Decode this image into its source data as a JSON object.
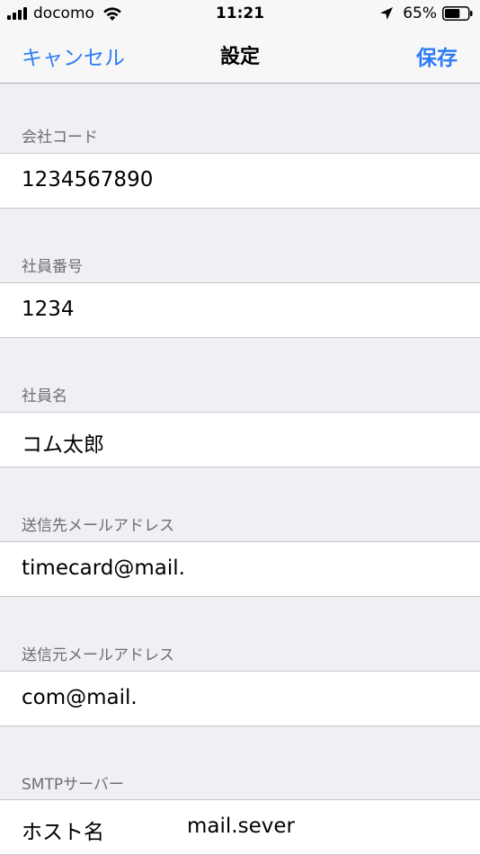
{
  "status_bar": {
    "carrier": "docomo",
    "time": "11:21",
    "battery_percent": "65%",
    "battery_level": 0.65
  },
  "nav": {
    "cancel_label": "キャンセル",
    "title": "設定",
    "save_label": "保存"
  },
  "sections": [
    {
      "header": "会社コード",
      "value": "1234567890"
    },
    {
      "header": "社員番号",
      "value": "1234"
    },
    {
      "header": "社員名",
      "value": "コム太郎"
    },
    {
      "header": "送信先メールアドレス",
      "value": "timecard@mail."
    },
    {
      "header": "送信元メールアドレス",
      "value": "com@mail."
    },
    {
      "header": "SMTPサーバー",
      "label": "ホスト名",
      "value": "mail.sever"
    }
  ],
  "colors": {
    "accent": "#2f7cf6",
    "background": "#efeff4",
    "section_header": "#6d6d72",
    "separator": "#c8c7cc"
  },
  "icons": [
    "signal-icon",
    "wifi-icon",
    "location-arrow-icon",
    "battery-icon"
  ]
}
